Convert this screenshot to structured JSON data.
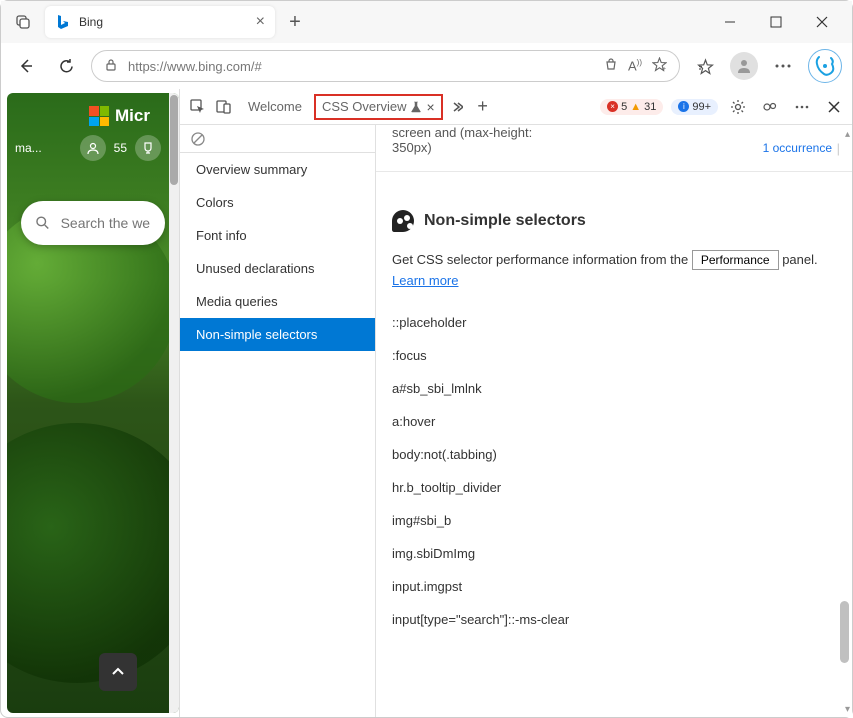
{
  "browser": {
    "tab_title": "Bing",
    "url": "https://www.bing.com/#"
  },
  "bing_page": {
    "logo_text": "Micr",
    "score": "55",
    "header_text": "ma...",
    "search_placeholder": "Search the we"
  },
  "devtools": {
    "tabs": {
      "welcome": "Welcome",
      "css_overview": "CSS Overview"
    },
    "counters": {
      "errors": "5",
      "warnings": "31",
      "messages": "99+"
    },
    "sidebar": {
      "items": [
        "Overview summary",
        "Colors",
        "Font info",
        "Unused declarations",
        "Media queries",
        "Non-simple selectors"
      ]
    },
    "prev_media": "screen and (max-height: 350px)",
    "occurrences": "1 occurrence",
    "section_title": "Non-simple selectors",
    "perf_text_1": "Get CSS selector performance information from the",
    "perf_button": "Performance",
    "perf_text_2": "panel.",
    "learn_more": "Learn more",
    "selectors": [
      "::placeholder",
      ":focus",
      "a#sb_sbi_lmlnk",
      "a:hover",
      "body:not(.tabbing)",
      "hr.b_tooltip_divider",
      "img#sbi_b",
      "img.sbiDmImg",
      "input.imgpst",
      "input[type=\"search\"]::-ms-clear"
    ]
  }
}
